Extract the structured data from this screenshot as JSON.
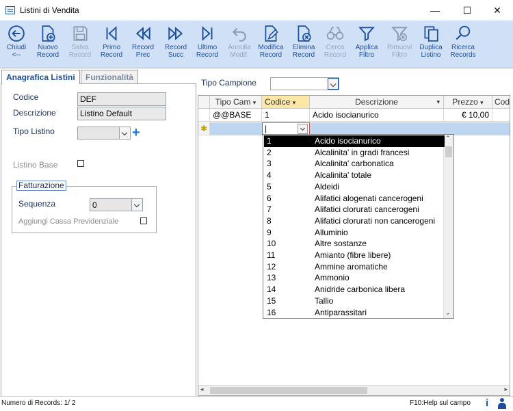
{
  "window": {
    "title": "Listini di Vendita",
    "minimize": "—",
    "maximize": "☐",
    "close": "✕"
  },
  "toolbar": [
    {
      "line1": "Chiudi",
      "line2": "<--",
      "icon": "back-arrow-icon",
      "enabled": true
    },
    {
      "line1": "Nuovo",
      "line2": "Record",
      "icon": "new-document-icon",
      "enabled": true
    },
    {
      "line1": "Salva",
      "line2": "Record",
      "icon": "save-icon",
      "enabled": false
    },
    {
      "line1": "Primo",
      "line2": "Record",
      "icon": "first-record-icon",
      "enabled": true
    },
    {
      "line1": "Record",
      "line2": "Prec",
      "icon": "previous-record-icon",
      "enabled": true
    },
    {
      "line1": "Record",
      "line2": "Succ",
      "icon": "next-record-icon",
      "enabled": true
    },
    {
      "line1": "Ultimo",
      "line2": "Record",
      "icon": "last-record-icon",
      "enabled": true
    },
    {
      "line1": "Annulla",
      "line2": "Modif.",
      "icon": "undo-icon",
      "enabled": false
    },
    {
      "line1": "Modifica",
      "line2": "Record",
      "icon": "edit-document-icon",
      "enabled": true
    },
    {
      "line1": "Elimina",
      "line2": "Record",
      "icon": "delete-document-icon",
      "enabled": true
    },
    {
      "line1": "Cerca",
      "line2": "Record",
      "icon": "binoculars-icon",
      "enabled": false
    },
    {
      "line1": "Applica",
      "line2": "Filtro",
      "icon": "filter-icon",
      "enabled": true
    },
    {
      "line1": "Rimuovi",
      "line2": "Filtro",
      "icon": "remove-filter-icon",
      "enabled": false
    },
    {
      "line1": "Duplica",
      "line2": "Listino",
      "icon": "duplicate-icon",
      "enabled": true
    },
    {
      "line1": "Ricerca",
      "line2": "Records",
      "icon": "search-icon",
      "enabled": true
    }
  ],
  "tabs": {
    "active": "Anagrafica Listini",
    "inactive": "Funzionalità"
  },
  "form": {
    "codice_label": "Codice",
    "codice_value": "DEF",
    "descrizione_label": "Descrizione",
    "descrizione_value": "Listino Default",
    "tipo_listino_label": "Tipo Listino",
    "tipo_listino_value": "",
    "listino_base_label": "Listino Base",
    "fatturazione_title": "Fatturazione",
    "sequenza_label": "Sequenza",
    "sequenza_value": "0",
    "cassa_label": "Aggiungi Cassa Previdenziale"
  },
  "tipo_campione": {
    "label": "Tipo Campione",
    "value": ""
  },
  "grid": {
    "headers": [
      "Tipo Cam",
      "Codice",
      "Descrizione",
      "Prezzo",
      "Cod"
    ],
    "rows": [
      {
        "tipo": "@@BASE",
        "codice": "1",
        "descrizione": "Acido isocianurico",
        "prezzo": "€ 10,00"
      }
    ],
    "new_row_marker": "✱",
    "editing_codice": "|"
  },
  "dropdown": {
    "items": [
      {
        "code": "1",
        "name": "Acido isocianurico"
      },
      {
        "code": "2",
        "name": "Alcalinita'  in gradi francesi"
      },
      {
        "code": "3",
        "name": "Alcalinita' carbonatica"
      },
      {
        "code": "4",
        "name": "Alcalinita' totale"
      },
      {
        "code": "5",
        "name": "Aldeidi"
      },
      {
        "code": "6",
        "name": "Alifatici alogenati cancerogeni"
      },
      {
        "code": "7",
        "name": "Alifatici clorurati cancerogeni"
      },
      {
        "code": "8",
        "name": "Alifatici clorurati non cancerogeni"
      },
      {
        "code": "9",
        "name": "Alluminio"
      },
      {
        "code": "10",
        "name": "Altre sostanze"
      },
      {
        "code": "11",
        "name": "Amianto (fibre libere)"
      },
      {
        "code": "12",
        "name": "Ammine aromatiche"
      },
      {
        "code": "13",
        "name": "Ammonio"
      },
      {
        "code": "14",
        "name": "Anidride carbonica libera"
      },
      {
        "code": "15",
        "name": "Tallio"
      },
      {
        "code": "16",
        "name": "Antiparassitari"
      }
    ]
  },
  "status": {
    "records": "Numero di Records: 1/ 2",
    "help": "F10:Help sul campo"
  },
  "colors": {
    "toolbar_bg": "#cfe0f7",
    "accent": "#1c4f9c",
    "selected_header": "#fce7a6",
    "new_row": "#bed6f0"
  }
}
